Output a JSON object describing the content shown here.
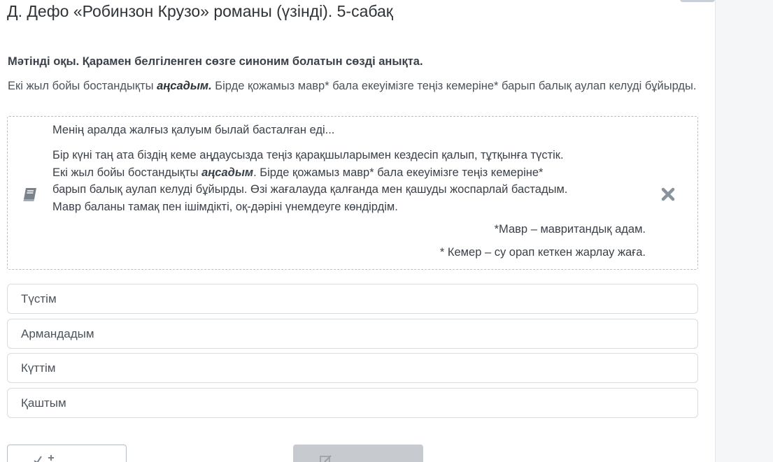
{
  "lesson": {
    "title": "Д. Дефо «Робинзон Крузо» романы (үзінді). 5-сабақ"
  },
  "task": {
    "instruction": "Мәтінді оқы. Қарамен белгіленген сөзге синоним болатын сөзді анықта.",
    "intro_before": "Екі жыл бойы бостандықты ",
    "intro_bold": "аңсадым.",
    "intro_after": " Бірде қожамыз мавр* бала екеуімізге теңіз кемеріне* барып балық аулап келуді бұйырды."
  },
  "reading_text": {
    "icon": "book-icon",
    "close_icon": "close-icon",
    "first_line": "Менің аралда жалғыз қалуым былай басталған еді...",
    "line1": "Бір күні таң ата біздің кеме аңдаусызда теңіз қарақшыларымен кездесіп қалып, тұтқынға түстік.",
    "line2_before": "Екі жыл бойы бостандықты ",
    "line2_bold": "аңсадым",
    "line2_after": ". Бірде қожамыз мавр* бала екеуімізге теңіз кемеріне*",
    "line3": "барып балық аулап келуді бұйырды. Өзі жағалауда қалғанда мен қашуды жоспарлай бастадым.",
    "line4": "Мавр баланы тамақ пен ішімдікті, оқ-дәріні үнемдеуге көндірдім.",
    "note1": "*Мавр – мавритандық адам.",
    "note2": "* Кемер – су орап кеткен жарлау жаға."
  },
  "options": [
    "Түстім",
    "Армандадым",
    "Күттім",
    "Қаштым"
  ],
  "footer": {
    "left_button_icon": "check-icon",
    "right_button_icon": "edit-icon"
  },
  "colors": {
    "text": "#333840",
    "border": "#d8dde2",
    "disabled_button": "#c7cbd0",
    "icon": "#7a828b"
  }
}
